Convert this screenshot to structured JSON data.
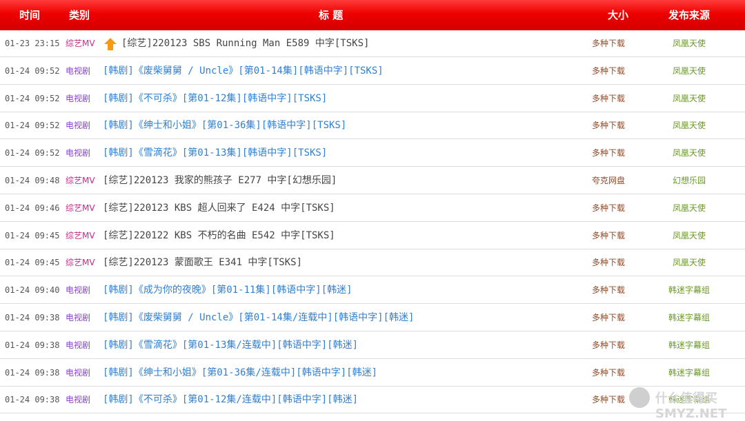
{
  "header": {
    "time": "时间",
    "category": "类别",
    "title": "标 题",
    "size": "大小",
    "source": "发布来源"
  },
  "colors": {
    "header_red": "#e80000",
    "variety_category": "#c52a8a",
    "tv_category": "#8a3ed0",
    "variety_title": "#444444",
    "tv_title": "#2f7fd2",
    "size": "#8f4a2a",
    "source": "#6a9a24"
  },
  "rows": [
    {
      "time": "01-23 23:15",
      "category": "综艺MV",
      "title": "[综艺]220123 SBS Running Man E589 中字[TSKS]",
      "size": "多种下载",
      "source": "凤凰天使",
      "kind": "variety",
      "icon": "up-arrow-icon"
    },
    {
      "time": "01-24 09:52",
      "category": "电视剧",
      "title": "[韩剧]《废柴舅舅 / Uncle》[第01-14集][韩语中字][TSKS]",
      "size": "多种下载",
      "source": "凤凰天使",
      "kind": "tv"
    },
    {
      "time": "01-24 09:52",
      "category": "电视剧",
      "title": "[韩剧]《不可杀》[第01-12集][韩语中字][TSKS]",
      "size": "多种下载",
      "source": "凤凰天使",
      "kind": "tv"
    },
    {
      "time": "01-24 09:52",
      "category": "电视剧",
      "title": "[韩剧]《绅士和小姐》[第01-36集][韩语中字][TSKS]",
      "size": "多种下载",
      "source": "凤凰天使",
      "kind": "tv"
    },
    {
      "time": "01-24 09:52",
      "category": "电视剧",
      "title": "[韩剧]《雪滴花》[第01-13集][韩语中字][TSKS]",
      "size": "多种下载",
      "source": "凤凰天使",
      "kind": "tv"
    },
    {
      "time": "01-24 09:48",
      "category": "综艺MV",
      "title": "[综艺]220123 我家的熊孩子 E277 中字[幻想乐园]",
      "size": "夸克网盘",
      "source": "幻想乐园",
      "kind": "variety"
    },
    {
      "time": "01-24 09:46",
      "category": "综艺MV",
      "title": "[综艺]220123 KBS 超人回来了 E424 中字[TSKS]",
      "size": "多种下载",
      "source": "凤凰天使",
      "kind": "variety"
    },
    {
      "time": "01-24 09:45",
      "category": "综艺MV",
      "title": "[综艺]220122 KBS 不朽的名曲 E542 中字[TSKS]",
      "size": "多种下载",
      "source": "凤凰天使",
      "kind": "variety"
    },
    {
      "time": "01-24 09:45",
      "category": "综艺MV",
      "title": "[综艺]220123 蒙面歌王 E341 中字[TSKS]",
      "size": "多种下载",
      "source": "凤凰天使",
      "kind": "variety"
    },
    {
      "time": "01-24 09:40",
      "category": "电视剧",
      "title": "[韩剧]《成为你的夜晚》[第01-11集][韩语中字][韩迷]",
      "size": "多种下载",
      "source": "韩迷字幕组",
      "kind": "tv"
    },
    {
      "time": "01-24 09:38",
      "category": "电视剧",
      "title": "[韩剧]《废柴舅舅 / Uncle》[第01-14集/连载中][韩语中字][韩迷]",
      "size": "多种下载",
      "source": "韩迷字幕组",
      "kind": "tv"
    },
    {
      "time": "01-24 09:38",
      "category": "电视剧",
      "title": "[韩剧]《雪滴花》[第01-13集/连载中][韩语中字][韩迷]",
      "size": "多种下载",
      "source": "韩迷字幕组",
      "kind": "tv"
    },
    {
      "time": "01-24 09:38",
      "category": "电视剧",
      "title": "[韩剧]《绅士和小姐》[第01-36集/连载中][韩语中字][韩迷]",
      "size": "多种下载",
      "source": "韩迷字幕组",
      "kind": "tv"
    },
    {
      "time": "01-24 09:38",
      "category": "电视剧",
      "title": "[韩剧]《不可杀》[第01-12集/连载中][韩语中字][韩迷]",
      "size": "多种下载",
      "source": "韩迷字幕组",
      "kind": "tv"
    }
  ],
  "watermark": {
    "text": "什么值得买 SMYZ.NET"
  }
}
